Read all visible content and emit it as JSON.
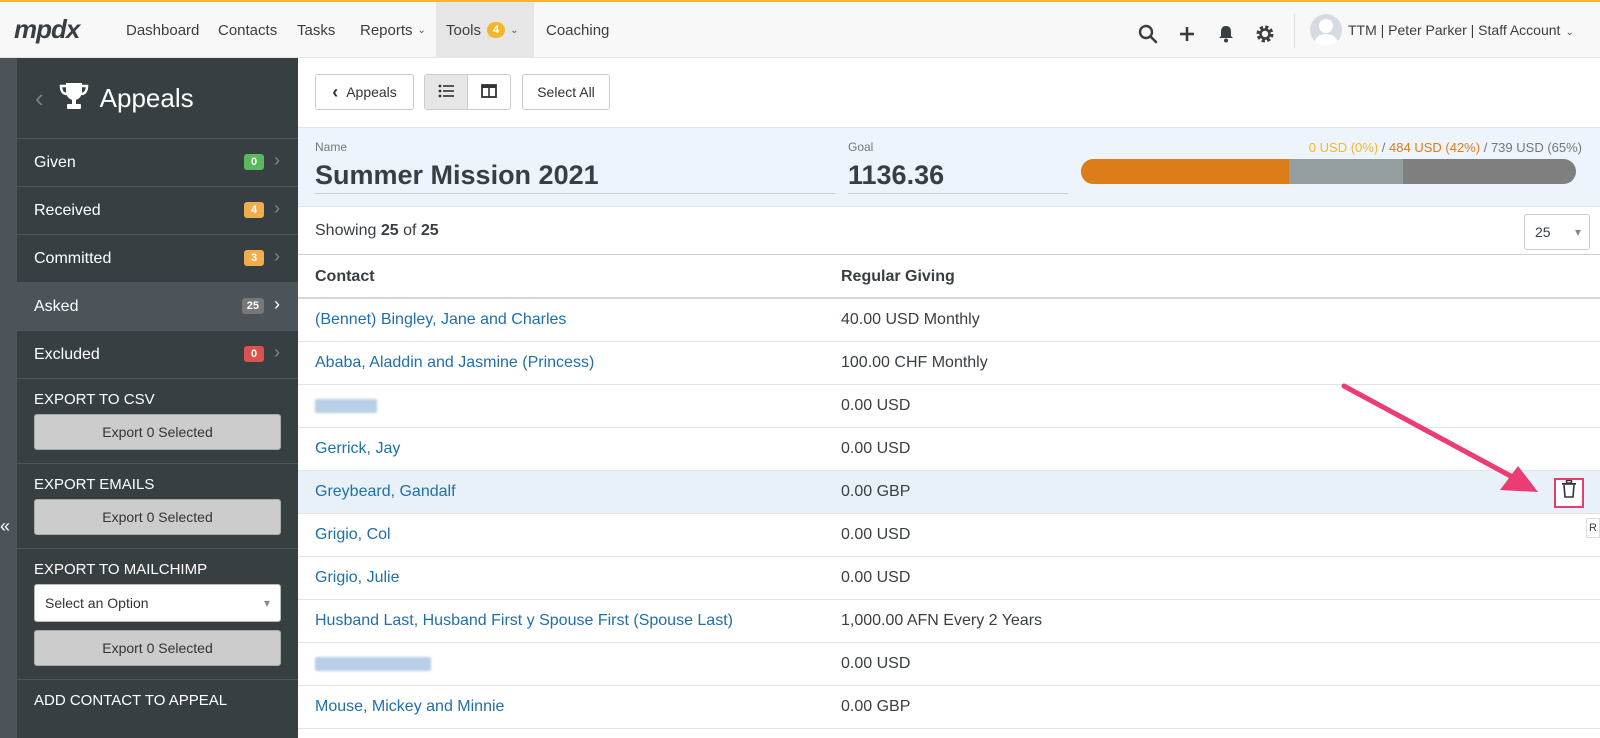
{
  "app": {
    "logo": "mpdx"
  },
  "topnav": {
    "items": [
      {
        "label": "Dashboard"
      },
      {
        "label": "Contacts"
      },
      {
        "label": "Tasks"
      },
      {
        "label": "Reports"
      },
      {
        "label": "Tools",
        "badge": "4"
      },
      {
        "label": "Coaching"
      }
    ],
    "account": "TTM | Peter Parker | Staff Account"
  },
  "sidebar": {
    "title": "Appeals",
    "items": [
      {
        "label": "Given",
        "count": "0",
        "color": "#5cb85c"
      },
      {
        "label": "Received",
        "count": "4",
        "color": "#f0ad4e"
      },
      {
        "label": "Committed",
        "count": "3",
        "color": "#f0ad4e"
      },
      {
        "label": "Asked",
        "count": "25",
        "color": "#777777"
      },
      {
        "label": "Excluded",
        "count": "0",
        "color": "#d9534f"
      }
    ],
    "export_csv": {
      "heading": "EXPORT TO CSV",
      "button": "Export 0 Selected"
    },
    "export_emails": {
      "heading": "EXPORT EMAILS",
      "button": "Export 0 Selected"
    },
    "export_mailchimp": {
      "heading": "EXPORT TO MAILCHIMP",
      "select": "Select an Option",
      "button": "Export 0 Selected"
    },
    "add_contact": {
      "heading": "ADD CONTACT TO APPEAL"
    }
  },
  "toolbar": {
    "back": "Appeals",
    "select_all": "Select All"
  },
  "appeal": {
    "name_label": "Name",
    "name": "Summer Mission 2021",
    "goal_label": "Goal",
    "goal": "1136.36",
    "given": "0 USD (0%)",
    "received": "484 USD (42%)",
    "committed": "739 USD (65%)",
    "sep": "/",
    "progress": {
      "given_pct": 0,
      "received_pct": 42,
      "committed_pct": 65
    }
  },
  "listing": {
    "showing_prefix": "Showing",
    "shown": "25",
    "of": "of",
    "total": "25",
    "per_page": "25"
  },
  "table": {
    "headers": {
      "contact": "Contact",
      "giving": "Regular Giving"
    },
    "rows": [
      {
        "contact": "(Bennet) Bingley, Jane and Charles",
        "giving": "40.00 USD Monthly"
      },
      {
        "contact": "Ababa, Aladdin and Jasmine (Princess)",
        "giving": "100.00 CHF Monthly"
      },
      {
        "contact": "",
        "giving": "0.00 USD"
      },
      {
        "contact": "Gerrick, Jay",
        "giving": "0.00 USD"
      },
      {
        "contact": "Greybeard, Gandalf",
        "giving": "0.00 GBP"
      },
      {
        "contact": "Grigio, Col",
        "giving": "0.00 USD"
      },
      {
        "contact": "Grigio, Julie",
        "giving": "0.00 USD"
      },
      {
        "contact": "Husband Last, Husband First y Spouse First (Spouse Last)",
        "giving": "1,000.00 AFN Every 2 Years"
      },
      {
        "contact": "",
        "giving": "0.00 USD"
      },
      {
        "contact": "Mouse, Mickey and Minnie",
        "giving": "0.00 GBP"
      }
    ],
    "tooltip_fragment": "R"
  },
  "annotation": {
    "arrow_color": "#ec3c74"
  }
}
